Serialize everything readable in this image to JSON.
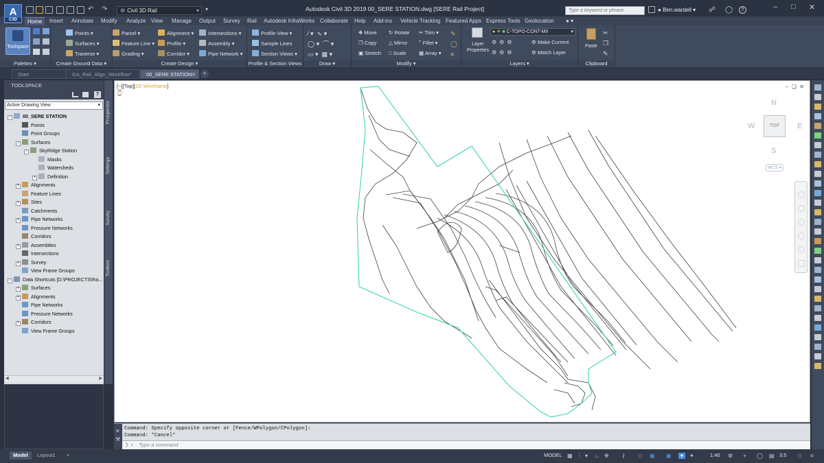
{
  "app": {
    "logo_text": "A",
    "logo_sub": "C3D",
    "workspace": "Civil 3D Rail",
    "title": "Autodesk Civil 3D 2019    00_SERE STATION.dwg [SERE Rail Project]",
    "search_placeholder": "Type a keyword or phrase",
    "user": "Ben.wardell",
    "help": "?"
  },
  "ribbon_tabs": [
    "Home",
    "Insert",
    "Annotate",
    "Modify",
    "Analyze",
    "View",
    "Manage",
    "Output",
    "Survey",
    "Rail",
    "Autodesk InfraWorks",
    "Collaborate",
    "Help",
    "Add-ins",
    "Vehicle Tracking",
    "Featured Apps",
    "Express Tools",
    "Geolocation"
  ],
  "active_tab": "Home",
  "ribbon": {
    "palettes": {
      "title": "Palettes",
      "toolspace": "Toolspace"
    },
    "ground": {
      "title": "Create Ground Data",
      "points": "Points",
      "surfaces": "Surfaces",
      "traverse": "Traverse"
    },
    "design": {
      "title": "Create Design",
      "parcel": "Parcel",
      "feature_line": "Feature Line",
      "grading": "Grading",
      "alignment": "Alignment",
      "profile": "Profile",
      "corridor": "Corridor",
      "intersections": "Intersections",
      "assembly": "Assembly",
      "pipe_network": "Pipe Network"
    },
    "profile_section": {
      "title": "Profile & Section Views",
      "profile_view": "Profile View",
      "sample_lines": "Sample Lines",
      "section_views": "Section Views"
    },
    "draw": {
      "title": "Draw"
    },
    "modify": {
      "title": "Modify",
      "move": "Move",
      "rotate": "Rotate",
      "trim": "Trim",
      "copy": "Copy",
      "mirror": "Mirror",
      "fillet": "Fillet",
      "stretch": "Stretch",
      "scale": "Scale",
      "array": "Array"
    },
    "layers": {
      "title": "Layers",
      "layer_properties": "Layer Properties",
      "current_layer": "C-TOPO-CONT-MII",
      "make_current": "Make Current",
      "match_layer": "Match Layer"
    },
    "clipboard": {
      "title": "Clipboard",
      "paste": "Paste"
    }
  },
  "doc_tabs": [
    "Start",
    "GA_Rail_Align_Workflow*",
    "00_SERE STATION"
  ],
  "active_doc": "00_SERE STATION",
  "toolspace": {
    "header": "TOOLSPACE",
    "view_select": "Active Drawing View",
    "side_tabs": [
      "Prospector",
      "Settings",
      "Survey",
      "Toolbox"
    ],
    "tree": [
      {
        "label": "00_SERE STATION",
        "level": 0,
        "toggle": "-",
        "bold": true,
        "icon": "drawing"
      },
      {
        "label": "Points",
        "level": 1,
        "toggle": "",
        "icon": "point"
      },
      {
        "label": "Point Groups",
        "level": 1,
        "toggle": "",
        "icon": "group"
      },
      {
        "label": "Surfaces",
        "level": 1,
        "toggle": "-",
        "icon": "surface"
      },
      {
        "label": "SkyRidge Station",
        "level": 2,
        "toggle": "-",
        "icon": "surface"
      },
      {
        "label": "Masks",
        "level": 3,
        "toggle": "",
        "icon": "folder"
      },
      {
        "label": "Watersheds",
        "level": 3,
        "toggle": "",
        "icon": "folder"
      },
      {
        "label": "Definition",
        "level": 3,
        "toggle": "+",
        "icon": "folder"
      },
      {
        "label": "Alignments",
        "level": 1,
        "toggle": "+",
        "icon": "alignment"
      },
      {
        "label": "Feature Lines",
        "level": 1,
        "toggle": "",
        "icon": "featureline"
      },
      {
        "label": "Sites",
        "level": 1,
        "toggle": "+",
        "icon": "site"
      },
      {
        "label": "Catchments",
        "level": 1,
        "toggle": "",
        "icon": "catchment"
      },
      {
        "label": "Pipe Networks",
        "level": 1,
        "toggle": "+",
        "icon": "pipe"
      },
      {
        "label": "Pressure Networks",
        "level": 1,
        "toggle": "",
        "icon": "pipe"
      },
      {
        "label": "Corridors",
        "level": 1,
        "toggle": "",
        "icon": "corridor"
      },
      {
        "label": "Assemblies",
        "level": 1,
        "toggle": "+",
        "icon": "assembly"
      },
      {
        "label": "Intersections",
        "level": 1,
        "toggle": "",
        "icon": "intersection"
      },
      {
        "label": "Survey",
        "level": 1,
        "toggle": "+",
        "icon": "survey"
      },
      {
        "label": "View Frame Groups",
        "level": 1,
        "toggle": "",
        "icon": "viewframe"
      },
      {
        "label": "Data Shortcuts [D:\\PROJECTS\\Ra...",
        "level": 0,
        "toggle": "-",
        "icon": "shortcut"
      },
      {
        "label": "Surfaces",
        "level": 1,
        "toggle": "+",
        "icon": "surface"
      },
      {
        "label": "Alignments",
        "level": 1,
        "toggle": "+",
        "icon": "alignment"
      },
      {
        "label": "Pipe Networks",
        "level": 1,
        "toggle": "",
        "icon": "pipe"
      },
      {
        "label": "Pressure Networks",
        "level": 1,
        "toggle": "",
        "icon": "pipe"
      },
      {
        "label": "Corridors",
        "level": 1,
        "toggle": "+",
        "icon": "corridor"
      },
      {
        "label": "View Frame Groups",
        "level": 1,
        "toggle": "",
        "icon": "viewframe"
      }
    ]
  },
  "viewport": {
    "label_prefix": "[−][Top][",
    "visual_style": "2D Wireframe",
    "label_suffix": "]",
    "compass": {
      "n": "N",
      "s": "S",
      "e": "E",
      "w": "W",
      "top": "TOP"
    },
    "ucs": "WCS"
  },
  "command": {
    "history": [
      "Command: Specify opposite corner or [Fence/WPolygon/CPolygon]:",
      "Command: *Cancel*"
    ],
    "placeholder": "Type a command"
  },
  "status": {
    "layout_tabs": [
      "Model",
      "Layout1"
    ],
    "active_layout": "Model",
    "space": "MODEL",
    "scale": "1:40",
    "elevation": "3.5"
  },
  "colors": {
    "boundary": "#40d2b4",
    "linework": "#3c3c3c",
    "ribbon_bg": "#3f4a5d",
    "accent": "#4a90d9"
  }
}
